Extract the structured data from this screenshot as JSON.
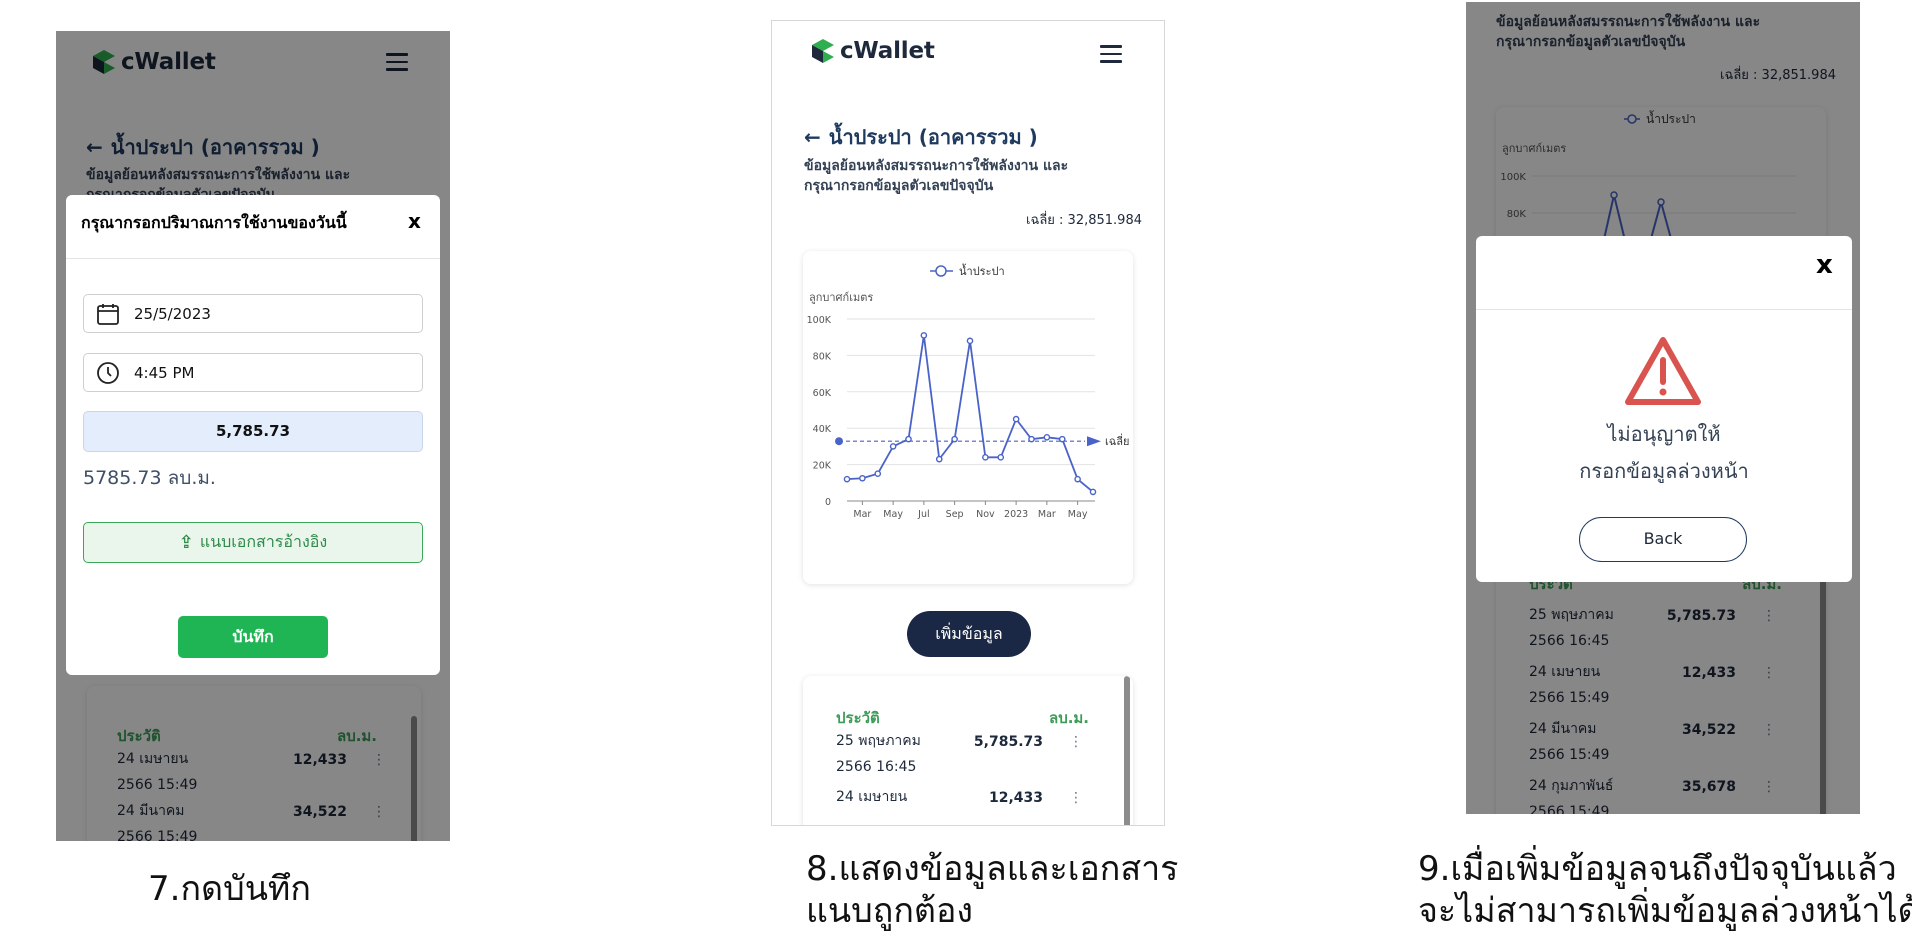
{
  "app": {
    "name": "cWallet"
  },
  "page": {
    "title": "น้ำประปา (อาคารรวม )",
    "subtitle_line1": "ข้อมูลย้อนหลังสมรรถนะการใช้พลังงาน และ",
    "subtitle_line2": "กรุณากรอกข้อมูลตัวเลขปัจจุบัน",
    "average": "เฉลี่ย : 32,851.984"
  },
  "modal_input": {
    "title": "กรุณากรอกปริมาณการใช้งานของวันนี้",
    "close": "x",
    "date_value": "25/5/2023",
    "time_value": "4:45 PM",
    "amount_value": "5,785.73",
    "unit_text": "5785.73 ลบ.ม.",
    "attach_label": "แนบเอกสารอ้างอิง",
    "save_label": "บันทึก"
  },
  "history": {
    "header_left": "ประวัติ",
    "header_right": "ลบ.ม.",
    "kebab": "⋮",
    "rows": [
      {
        "date_line1": "25 พฤษภาคม",
        "date_line2": "2566 16:45",
        "value": "5,785.73"
      },
      {
        "date_line1": "24 เมษายน",
        "date_line2": "2566 15:49",
        "value": "12,433"
      },
      {
        "date_line1": "24 มีนาคม",
        "date_line2": "2566 15:49",
        "value": "34,522"
      },
      {
        "date_line1": "24 กุมภาพันธ์",
        "date_line2": "2566 15:49",
        "value": "35,678"
      }
    ]
  },
  "add_button": "เพิ่มข้อมูล",
  "modal_warning": {
    "close": "x",
    "line1": "ไม่อนุญาตให้",
    "line2": "กรอกข้อมูลล่วงหน้า",
    "back_label": "Back"
  },
  "captions": {
    "c7": "7.กดบันทึก",
    "c8_line1": "8.แสดงข้อมูลและเอกสาร",
    "c8_line2": "แนบถูกต้อง",
    "c9_line1": "9.เมื่อเพิ่มข้อมูลจนถึงปัจจุบันแล้ว",
    "c9_line2": "จะไม่สามารถเพิ่มข้อมูลล่วงหน้าได้"
  },
  "colors": {
    "accent_green": "#1fb555",
    "navy": "#1b2845",
    "chart_line": "#4a63c8",
    "warning_red": "#d9534f"
  },
  "chart_data": {
    "type": "line",
    "legend": "น้ำประปา",
    "legend_position": "top-center",
    "ylabel": "ลูกบาศก์เมตร",
    "ylim": [
      0,
      100000
    ],
    "yticks": [
      "0",
      "20K",
      "40K",
      "60K",
      "80K",
      "100K"
    ],
    "xticks": [
      "Mar",
      "May",
      "Jul",
      "Sep",
      "Nov",
      "2023",
      "Mar",
      "May"
    ],
    "average_label": "เฉลี่ย",
    "average_value": 32852,
    "grid": true,
    "series": [
      {
        "name": "น้ำประปา",
        "values": [
          12000,
          12500,
          15000,
          30000,
          34000,
          91000,
          23000,
          34000,
          88000,
          24000,
          24000,
          45000,
          34000,
          35000,
          34000,
          12000,
          5000
        ]
      }
    ]
  }
}
